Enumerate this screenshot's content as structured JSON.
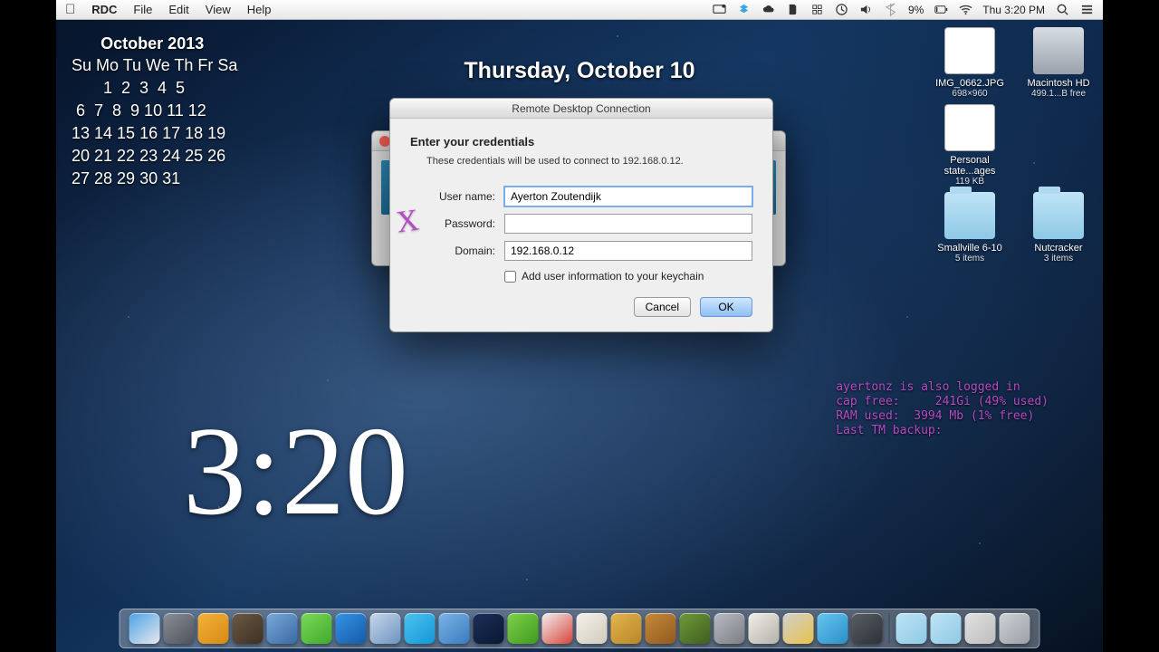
{
  "menubar": {
    "app_name": "RDC",
    "menus": [
      "File",
      "Edit",
      "View",
      "Help"
    ],
    "battery_pct": "9%",
    "battery_icon": "battery-icon",
    "clock": "Thu 3:20 PM"
  },
  "desktop": {
    "date_banner": "Thursday, October 10",
    "big_clock": "3:20",
    "calendar_title": "October 2013",
    "calendar_grid": " Su Mo Tu We Th Fr Sa\n        1  2  3  4  5\n  6  7  8  9 10 11 12\n 13 14 15 16 17 18 19\n 20 21 22 23 24 25 26\n 27 28 29 30 31",
    "sysinfo": "ayertonz is also logged in\ncap free:     241Gi (49% used)\nRAM used:  3994 Mb (1% free)\nLast TM backup:"
  },
  "desktop_icons": [
    {
      "name": "IMG_0662.JPG",
      "sub": "698×960",
      "kind": "page"
    },
    {
      "name": "Macintosh HD",
      "sub": "499.1...B free",
      "kind": "hd"
    },
    {
      "name": "Personal state...ages",
      "sub": "119 KB",
      "kind": "page"
    },
    {
      "name": "Smallville 6-10",
      "sub": "5 items",
      "kind": "folder"
    },
    {
      "name": "Nutcracker",
      "sub": "3 items",
      "kind": "folder"
    }
  ],
  "dialog": {
    "window_title": "Remote Desktop Connection",
    "heading": "Enter your credentials",
    "hint": "These credentials will be used to connect to 192.168.0.12.",
    "labels": {
      "username": "User name:",
      "password": "Password:",
      "domain": "Domain:"
    },
    "values": {
      "username": "Ayerton Zoutendijk",
      "password": "",
      "domain": "192.168.0.12"
    },
    "keychain_label": "Add user information to your keychain",
    "keychain_checked": false,
    "buttons": {
      "cancel": "Cancel",
      "ok": "OK"
    }
  },
  "dock_apps": [
    {
      "name": "finder",
      "c1": "#4aa3e6",
      "c2": "#e8e8ec"
    },
    {
      "name": "launchpad",
      "c1": "#8a8f99",
      "c2": "#4e525b"
    },
    {
      "name": "rdc",
      "c1": "#f4b23a",
      "c2": "#d68914"
    },
    {
      "name": "gimp",
      "c1": "#6b5a44",
      "c2": "#3d3024"
    },
    {
      "name": "safari",
      "c1": "#7aa9d8",
      "c2": "#3a6aa5"
    },
    {
      "name": "evernote",
      "c1": "#7ed957",
      "c2": "#3fa92c"
    },
    {
      "name": "xcode",
      "c1": "#3694e8",
      "c2": "#155aa5"
    },
    {
      "name": "itunes",
      "c1": "#c8d8ea",
      "c2": "#6d93c0"
    },
    {
      "name": "skype",
      "c1": "#4fc2f1",
      "c2": "#1297d6"
    },
    {
      "name": "appstore",
      "c1": "#7bb6e8",
      "c2": "#3a7abf"
    },
    {
      "name": "photoshop",
      "c1": "#1b2f59",
      "c2": "#0a1733"
    },
    {
      "name": "utorrent",
      "c1": "#7fd34a",
      "c2": "#3f9a1f"
    },
    {
      "name": "ical",
      "c1": "#f2f2f2",
      "c2": "#d8443a"
    },
    {
      "name": "reminders",
      "c1": "#f4f2ec",
      "c2": "#d0cabb"
    },
    {
      "name": "transmit",
      "c1": "#e5b54c",
      "c2": "#b8862a"
    },
    {
      "name": "handbrake",
      "c1": "#c88a3a",
      "c2": "#8f5a1f"
    },
    {
      "name": "minecraft",
      "c1": "#6f9a3a",
      "c2": "#3f5e1f"
    },
    {
      "name": "settings",
      "c1": "#b9bdc2",
      "c2": "#7a7e84"
    },
    {
      "name": "preview",
      "c1": "#f2efe8",
      "c2": "#b3b1a8"
    },
    {
      "name": "mail",
      "c1": "#d0d0d0",
      "c2": "#e8c24a"
    },
    {
      "name": "messages",
      "c1": "#67c6f2",
      "c2": "#2a8fc8"
    },
    {
      "name": "imovie",
      "c1": "#5a5f66",
      "c2": "#2e3136"
    }
  ],
  "dock_right": [
    {
      "name": "downloads",
      "c1": "#bfe4f5",
      "c2": "#8ec9e6"
    },
    {
      "name": "documents",
      "c1": "#bfe4f5",
      "c2": "#8ec9e6"
    },
    {
      "name": "stack",
      "c1": "#e2e2e2",
      "c2": "#bcbcbc"
    },
    {
      "name": "trash",
      "c1": "#cfd2d6",
      "c2": "#9aa0a7"
    }
  ]
}
